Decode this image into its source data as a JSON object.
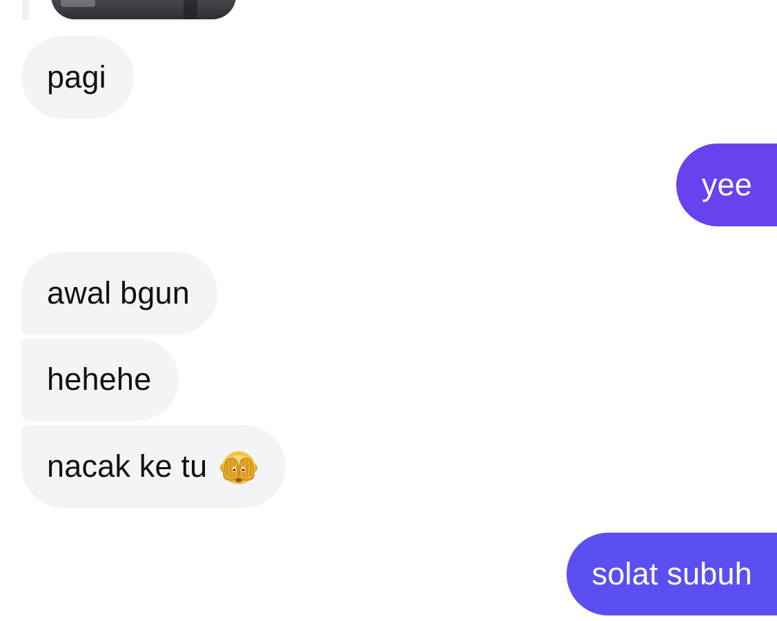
{
  "colors": {
    "incoming_bubble": "#f3f4f6",
    "incoming_text": "#111111",
    "outgoing_top": "#6742ee",
    "outgoing_bottom": "#5a4ff0",
    "outgoing_text": "#ffffff"
  },
  "messages": [
    {
      "id": "m1",
      "direction": "incoming",
      "text": "pagi"
    },
    {
      "id": "m2",
      "direction": "outgoing",
      "text": "yee"
    },
    {
      "id": "m3",
      "direction": "incoming",
      "text": "awal bgun"
    },
    {
      "id": "m4",
      "direction": "incoming",
      "text": "hehehe"
    },
    {
      "id": "m5",
      "direction": "incoming",
      "text": "nacak ke tu",
      "emoji": "see-no-evil-monkey-icon"
    },
    {
      "id": "m6",
      "direction": "outgoing",
      "text": "solat subuh"
    }
  ]
}
